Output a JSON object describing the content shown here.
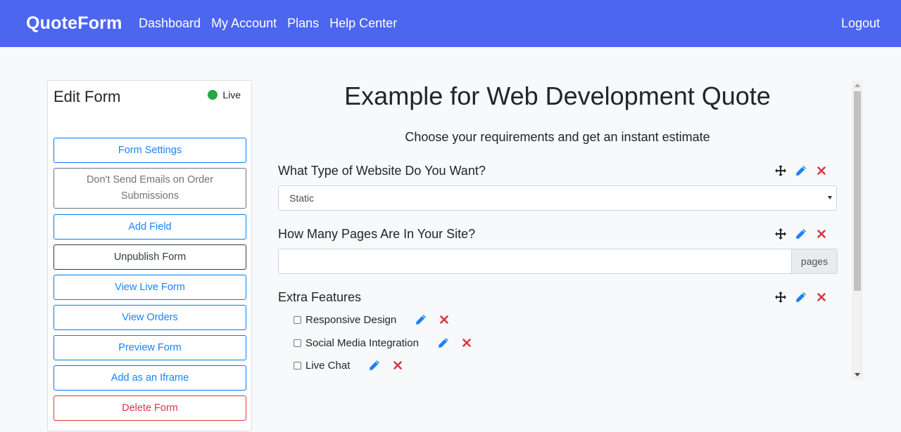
{
  "navbar": {
    "brand": "QuoteForm",
    "links": [
      "Dashboard",
      "My Account",
      "Plans",
      "Help Center"
    ],
    "logout": "Logout",
    "background": "#4c66f0"
  },
  "sidebar": {
    "title": "Edit Form",
    "status": "Live",
    "status_color": "#28a745",
    "buttons": {
      "form_settings": "Form Settings",
      "dont_send_emails": "Don't Send Emails on Order Submissions",
      "add_field": "Add Field",
      "unpublish": "Unpublish Form",
      "view_live": "View Live Form",
      "view_orders": "View Orders",
      "preview": "Preview Form",
      "add_iframe": "Add as an Iframe",
      "delete": "Delete Form"
    }
  },
  "main": {
    "title": "Example for Web Development Quote",
    "subtitle": "Choose your requirements and get an instant estimate",
    "fields": [
      {
        "label": "What Type of Website Do You Want?",
        "type": "select",
        "value": "Static"
      },
      {
        "label": "How Many Pages Are In Your Site?",
        "type": "number",
        "value": "",
        "addon": "pages"
      },
      {
        "label": "Extra Features",
        "type": "checkboxes",
        "options": [
          "Responsive Design",
          "Social Media Integration",
          "Live Chat"
        ]
      }
    ]
  },
  "icons": {
    "move": "move-icon",
    "edit": "pencil-icon",
    "delete": "close-icon",
    "edit_color": "#1a82f7",
    "delete_color": "#dc3545"
  }
}
